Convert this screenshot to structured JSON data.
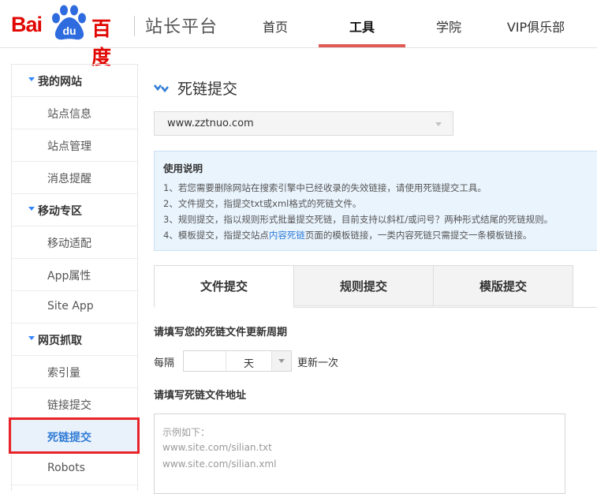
{
  "logo": {
    "bai": "Bai",
    "du": "du",
    "cn": "百度"
  },
  "site_title": "站长平台",
  "nav": [
    {
      "label": "首页",
      "active": false
    },
    {
      "label": "工具",
      "active": true
    },
    {
      "label": "学院",
      "active": false
    },
    {
      "label": "VIP俱乐部",
      "active": false
    }
  ],
  "sidebar": [
    {
      "type": "group",
      "label": "我的网站"
    },
    {
      "type": "item",
      "label": "站点信息"
    },
    {
      "type": "item",
      "label": "站点管理"
    },
    {
      "type": "item",
      "label": "消息提醒"
    },
    {
      "type": "group",
      "label": "移动专区"
    },
    {
      "type": "item",
      "label": "移动适配"
    },
    {
      "type": "item",
      "label": "App属性"
    },
    {
      "type": "item",
      "label": "Site App"
    },
    {
      "type": "group",
      "label": "网页抓取"
    },
    {
      "type": "item",
      "label": "索引量"
    },
    {
      "type": "item",
      "label": "链接提交"
    },
    {
      "type": "item",
      "label": "死链提交",
      "active": true
    },
    {
      "type": "item",
      "label": "Robots"
    }
  ],
  "main": {
    "title": "死链提交",
    "site_select": "www.zztnuo.com",
    "info": {
      "head": "使用说明",
      "line1": "1、若您需要删除网站在搜索引擎中已经收录的失效链接，请使用死链提交工具。",
      "line2": "2、文件提交，指提交txt或xml格式的死链文件。",
      "line3": "3、规则提交，指以规则形式批量提交死链，目前支持以斜杠/或问号？两种形式结尾的死链规则。",
      "line4_pre": "4、模板提交，指提交站点",
      "line4_link": "内容死链",
      "line4_post": "页面的模板链接，一类内容死链只需提交一条模板链接。"
    },
    "tabs": [
      {
        "label": "文件提交",
        "active": true
      },
      {
        "label": "规则提交",
        "active": false
      },
      {
        "label": "模版提交",
        "active": false
      }
    ],
    "period_label": "请填写您的死链文件更新周期",
    "period_prefix": "每隔",
    "period_value": "",
    "period_unit": "天",
    "period_suffix": "更新一次",
    "address_label": "请填写死链文件地址",
    "textarea_lines": [
      "示例如下：",
      "www.site.com/silian.txt",
      "www.site.com/silian.xml"
    ]
  },
  "colors": {
    "brand_red": "#e10601",
    "accent_blue": "#2f7bd6",
    "highlight_box": "#e8242a"
  }
}
